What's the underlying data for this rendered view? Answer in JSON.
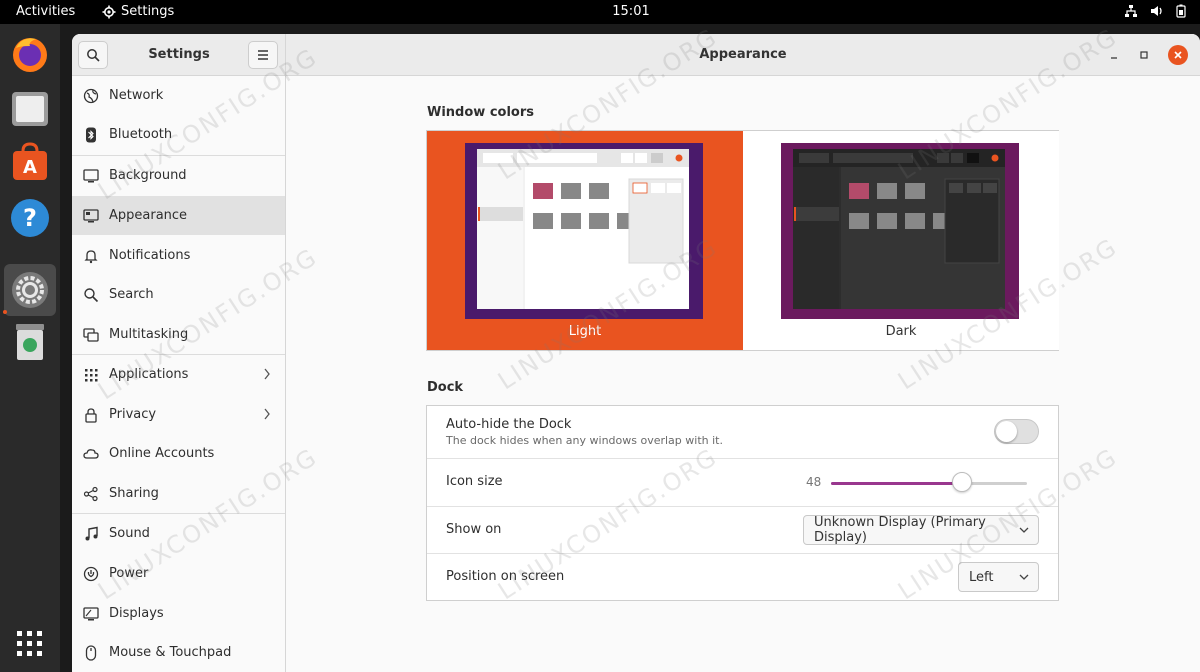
{
  "topbar": {
    "activities": "Activities",
    "app_name": "Settings",
    "clock": "15:01"
  },
  "dock": {
    "items": [
      "firefox-icon",
      "files-icon",
      "software-icon",
      "help-icon",
      "settings-icon",
      "trash-icon"
    ],
    "show_apps": "apps-grid-icon"
  },
  "window": {
    "sidebar_title": "Settings",
    "page_title": "Appearance"
  },
  "sidebar": {
    "items": [
      {
        "label": "Network"
      },
      {
        "label": "Bluetooth"
      },
      {
        "label": "Background"
      },
      {
        "label": "Appearance",
        "selected": true
      },
      {
        "label": "Notifications"
      },
      {
        "label": "Search"
      },
      {
        "label": "Multitasking"
      },
      {
        "label": "Applications"
      },
      {
        "label": "Privacy"
      },
      {
        "label": "Online Accounts"
      },
      {
        "label": "Sharing"
      },
      {
        "label": "Sound"
      },
      {
        "label": "Power"
      },
      {
        "label": "Displays"
      },
      {
        "label": "Mouse & Touchpad"
      }
    ]
  },
  "appearance": {
    "window_colors_title": "Window colors",
    "light_label": "Light",
    "dark_label": "Dark",
    "selected_theme": "Light",
    "accent_color": "#e95420",
    "dock_title": "Dock",
    "autohide_label": "Auto-hide the Dock",
    "autohide_desc": "The dock hides when any windows overlap with it.",
    "autohide_on": false,
    "icon_size_label": "Icon size",
    "icon_size_value": "48",
    "icon_size_fraction": 0.67,
    "show_on_label": "Show on",
    "show_on_value": "Unknown Display (Primary Display)",
    "position_label": "Position on screen",
    "position_value": "Left"
  },
  "watermark": "LINUXCONFIG.ORG"
}
